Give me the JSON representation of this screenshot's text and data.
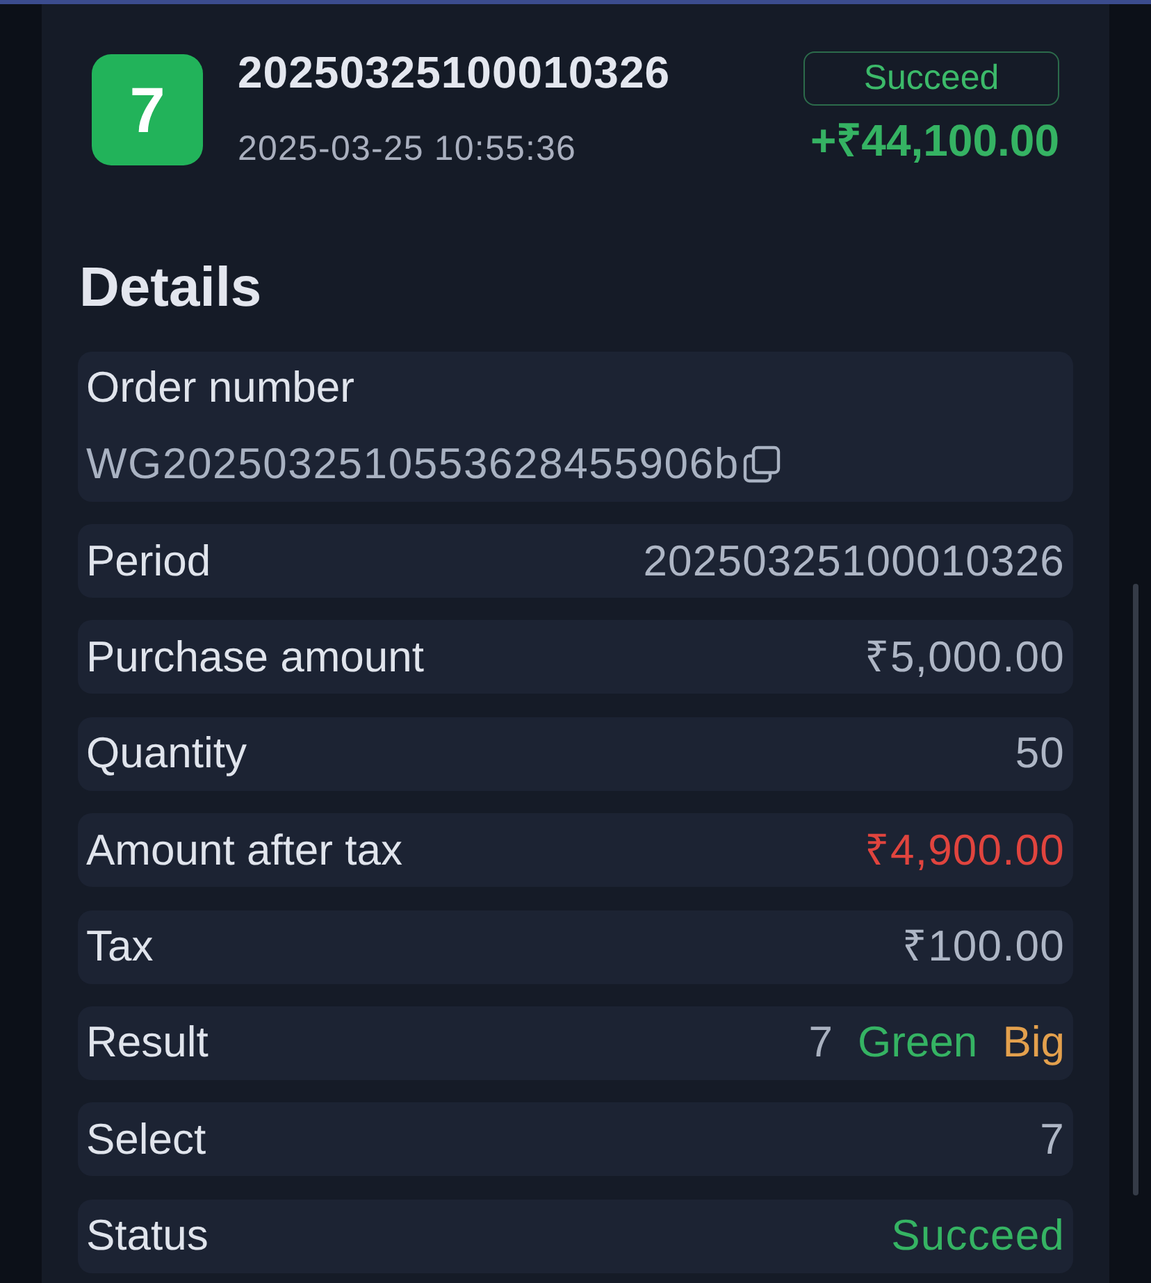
{
  "header": {
    "badge": "7",
    "period": "20250325100010326",
    "time": "2025-03-25 10:55:36",
    "status": "Succeed",
    "amount": "+₹44,100.00"
  },
  "details": {
    "title": "Details",
    "order": {
      "label": "Order number",
      "value": "WG2025032510553628455906b"
    },
    "rows": [
      {
        "kind": "plain",
        "label": "Period",
        "value": "20250325100010326"
      },
      {
        "kind": "plain",
        "label": "Purchase amount",
        "value": "₹5,000.00"
      },
      {
        "kind": "plain",
        "label": "Quantity",
        "value": "50"
      },
      {
        "kind": "loss",
        "label": "Amount after tax",
        "value": "₹4,900.00"
      },
      {
        "kind": "plain",
        "label": "Tax",
        "value": "₹100.00"
      },
      {
        "kind": "result",
        "label": "Result",
        "parts": [
          {
            "text": "7",
            "color": "#a9b1c0"
          },
          {
            "text": "Green",
            "color": "#35b363"
          },
          {
            "text": "Big",
            "color": "#e3a04d"
          }
        ]
      },
      {
        "kind": "plain",
        "label": "Select",
        "value": "7"
      },
      {
        "kind": "gain",
        "label": "Status",
        "value": "Succeed"
      }
    ]
  }
}
